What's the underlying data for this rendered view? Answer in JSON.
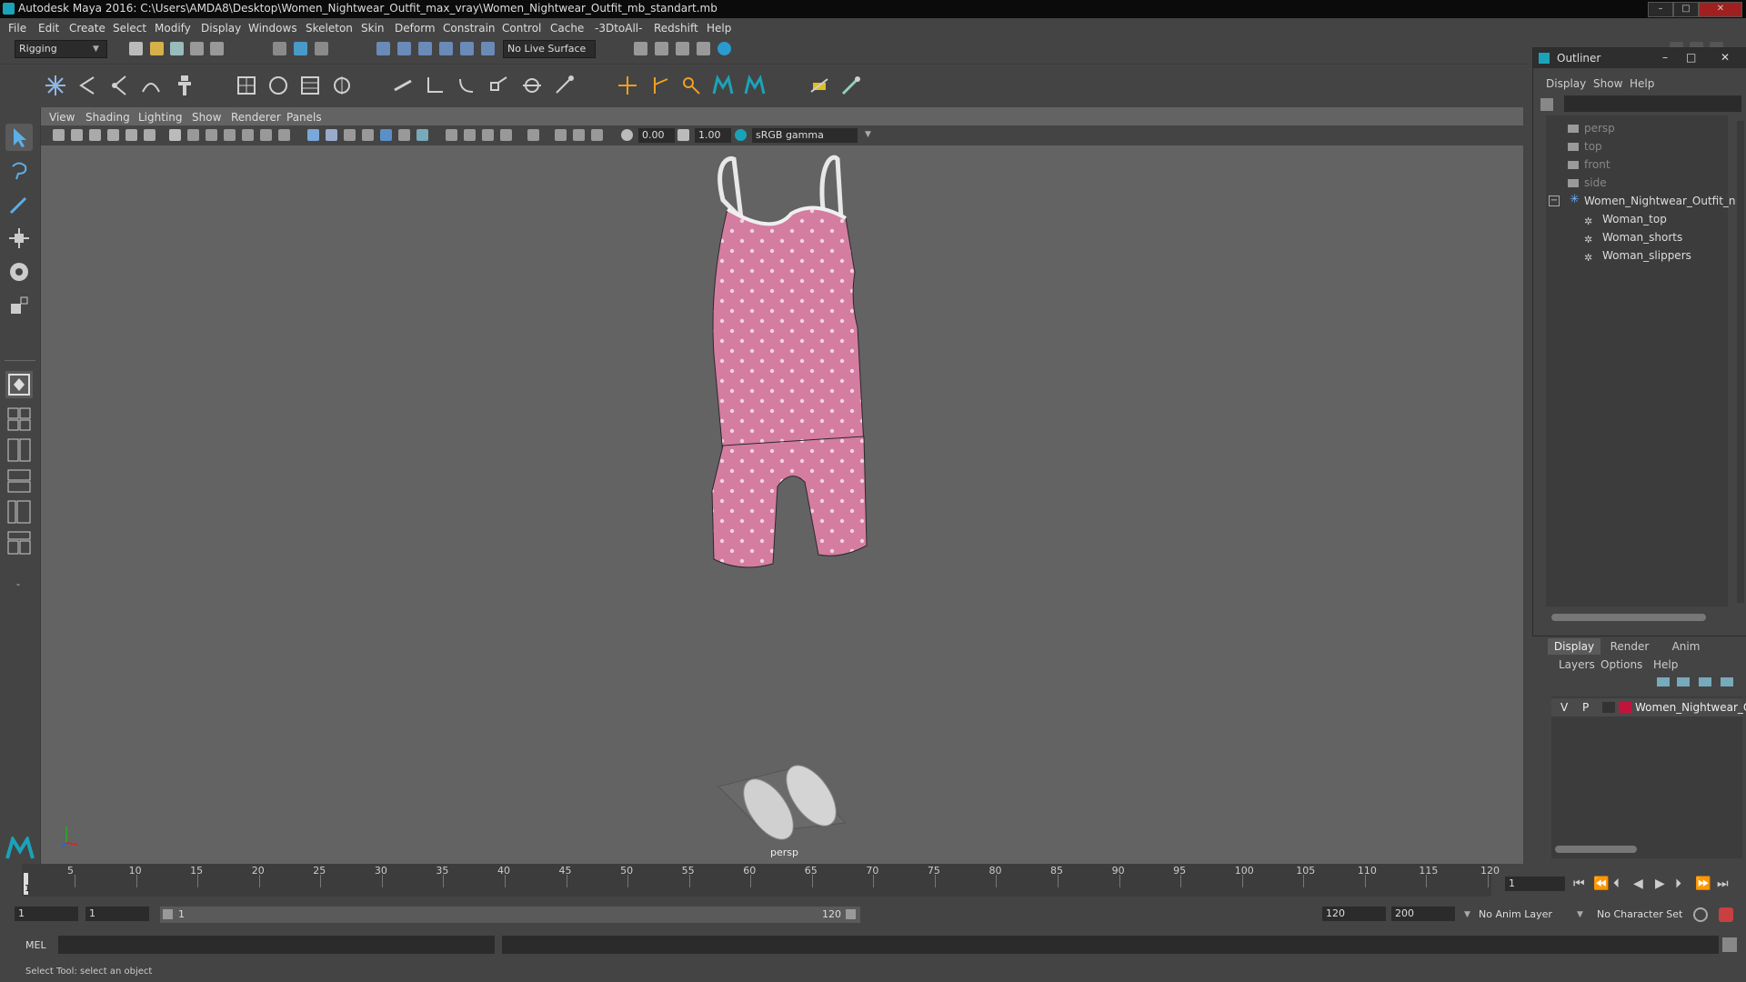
{
  "window": {
    "title": "Autodesk Maya 2016: C:\\Users\\AMDA8\\Desktop\\Women_Nightwear_Outfit_max_vray\\Women_Nightwear_Outfit_mb_standart.mb",
    "min": "–",
    "max": "□",
    "close": "✕"
  },
  "menubar": [
    "File",
    "Edit",
    "Create",
    "Select",
    "Modify",
    "Display",
    "Windows",
    "Skeleton",
    "Skin",
    "Deform",
    "Constrain",
    "Control",
    "Cache",
    "-3DtoAll-",
    "Redshift",
    "Help"
  ],
  "shelf": {
    "mode": "Rigging",
    "live_surface": "No Live Surface"
  },
  "viewport": {
    "menu": [
      "View",
      "Shading",
      "Lighting",
      "Show",
      "Renderer",
      "Panels"
    ],
    "exposure": "0.00",
    "gamma": "1.00",
    "color_space": "sRGB gamma",
    "camera_label": "persp"
  },
  "outliner": {
    "title": "Outliner",
    "menu": [
      "Display",
      "Show",
      "Help"
    ],
    "items": [
      {
        "label": "persp",
        "level": 0
      },
      {
        "label": "top",
        "level": 0
      },
      {
        "label": "front",
        "level": 0
      },
      {
        "label": "side",
        "level": 0
      },
      {
        "label": "Women_Nightwear_Outfit_n",
        "level": 0
      },
      {
        "label": "Woman_top",
        "level": 1
      },
      {
        "label": "Woman_shorts",
        "level": 1
      },
      {
        "label": "Woman_slippers",
        "level": 1
      }
    ]
  },
  "layers": {
    "tabs": [
      "Display",
      "Render",
      "Anim"
    ],
    "menu": [
      "Layers",
      "Options",
      "Help"
    ],
    "row": {
      "v": "V",
      "p": "P",
      "name": "Women_Nightwear_O",
      "color": "#c0143c"
    }
  },
  "timeline": {
    "ticks": [
      5,
      10,
      15,
      20,
      25,
      30,
      35,
      40,
      45,
      50,
      55,
      60,
      65,
      70,
      75,
      80,
      85,
      90,
      95,
      100,
      105,
      110,
      115,
      120
    ],
    "current_frame": "1",
    "current_field": "1"
  },
  "range": {
    "start": "1",
    "anim_start": "1",
    "slider_start": "1",
    "slider_end": "120",
    "end": "120",
    "anim_end": "200",
    "anim_layer": "No Anim Layer",
    "char_set": "No Character Set"
  },
  "cmd": {
    "label": "MEL"
  },
  "help": {
    "text": "Select Tool: select an object"
  },
  "colors": {
    "accent": "#1aa3b8",
    "garment": "#d47da0",
    "layer": "#c0143c"
  }
}
